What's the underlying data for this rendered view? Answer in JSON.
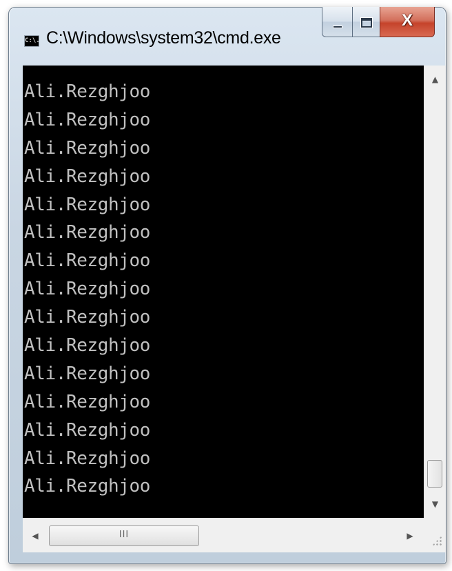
{
  "window": {
    "title": "C:\\Windows\\system32\\cmd.exe",
    "icon_label": "C:\\."
  },
  "console": {
    "lines": [
      "Ali.Rezghjoo",
      "Ali.Rezghjoo",
      "Ali.Rezghjoo",
      "Ali.Rezghjoo",
      "Ali.Rezghjoo",
      "Ali.Rezghjoo",
      "Ali.Rezghjoo",
      "Ali.Rezghjoo",
      "Ali.Rezghjoo",
      "Ali.Rezghjoo",
      "Ali.Rezghjoo",
      "Ali.Rezghjoo",
      "Ali.Rezghjoo",
      "Ali.Rezghjoo",
      "Ali.Rezghjoo"
    ],
    "text_color": "#c0c0c0",
    "background_color": "#000000"
  },
  "scrollbars": {
    "vertical": {
      "up_glyph": "▲",
      "down_glyph": "▼"
    },
    "horizontal": {
      "left_glyph": "◀",
      "right_glyph": "▶",
      "thumb_grip": "III"
    }
  },
  "caption_buttons": {
    "close_glyph": "X"
  }
}
